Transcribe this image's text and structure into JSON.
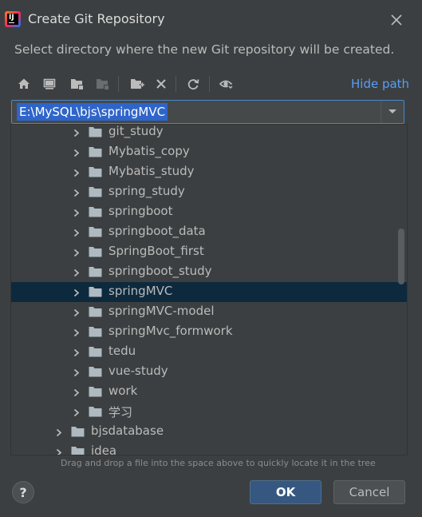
{
  "dialog": {
    "title": "Create Git Repository",
    "subtitle": "Select directory where the new Git repository will be created."
  },
  "toolbar": {
    "hide_path_label": "Hide path",
    "icons": [
      "home-icon",
      "desktop-icon",
      "project-folder-icon",
      "module-folder-icon",
      "new-folder-icon",
      "delete-icon",
      "refresh-icon",
      "show-hidden-icon"
    ]
  },
  "path": {
    "value": "E:\\MySQL\\bjs\\springMVC"
  },
  "tree": {
    "items": [
      {
        "label": "git_study",
        "level": 2,
        "selected": false
      },
      {
        "label": "Mybatis_copy",
        "level": 2,
        "selected": false
      },
      {
        "label": "Mybatis_study",
        "level": 2,
        "selected": false
      },
      {
        "label": "spring_study",
        "level": 2,
        "selected": false
      },
      {
        "label": "springboot",
        "level": 2,
        "selected": false
      },
      {
        "label": "springboot_data",
        "level": 2,
        "selected": false
      },
      {
        "label": "SpringBoot_first",
        "level": 2,
        "selected": false
      },
      {
        "label": "springboot_study",
        "level": 2,
        "selected": false
      },
      {
        "label": "springMVC",
        "level": 2,
        "selected": true
      },
      {
        "label": "springMVC-model",
        "level": 2,
        "selected": false
      },
      {
        "label": "springMvc_formwork",
        "level": 2,
        "selected": false
      },
      {
        "label": "tedu",
        "level": 2,
        "selected": false
      },
      {
        "label": "vue-study",
        "level": 2,
        "selected": false
      },
      {
        "label": "work",
        "level": 2,
        "selected": false
      },
      {
        "label": "学习",
        "level": 2,
        "selected": false
      },
      {
        "label": "bjsdatabase",
        "level": 1,
        "selected": false
      },
      {
        "label": "idea",
        "level": 1,
        "selected": false
      }
    ]
  },
  "hint": "Drag and drop a file into the space above to quickly locate it in the tree",
  "buttons": {
    "help_label": "?",
    "ok_label": "OK",
    "cancel_label": "Cancel"
  },
  "colors": {
    "background": "#3c3f41",
    "selection": "#0d293e",
    "accent_link": "#589df6",
    "ok_button": "#365880"
  }
}
